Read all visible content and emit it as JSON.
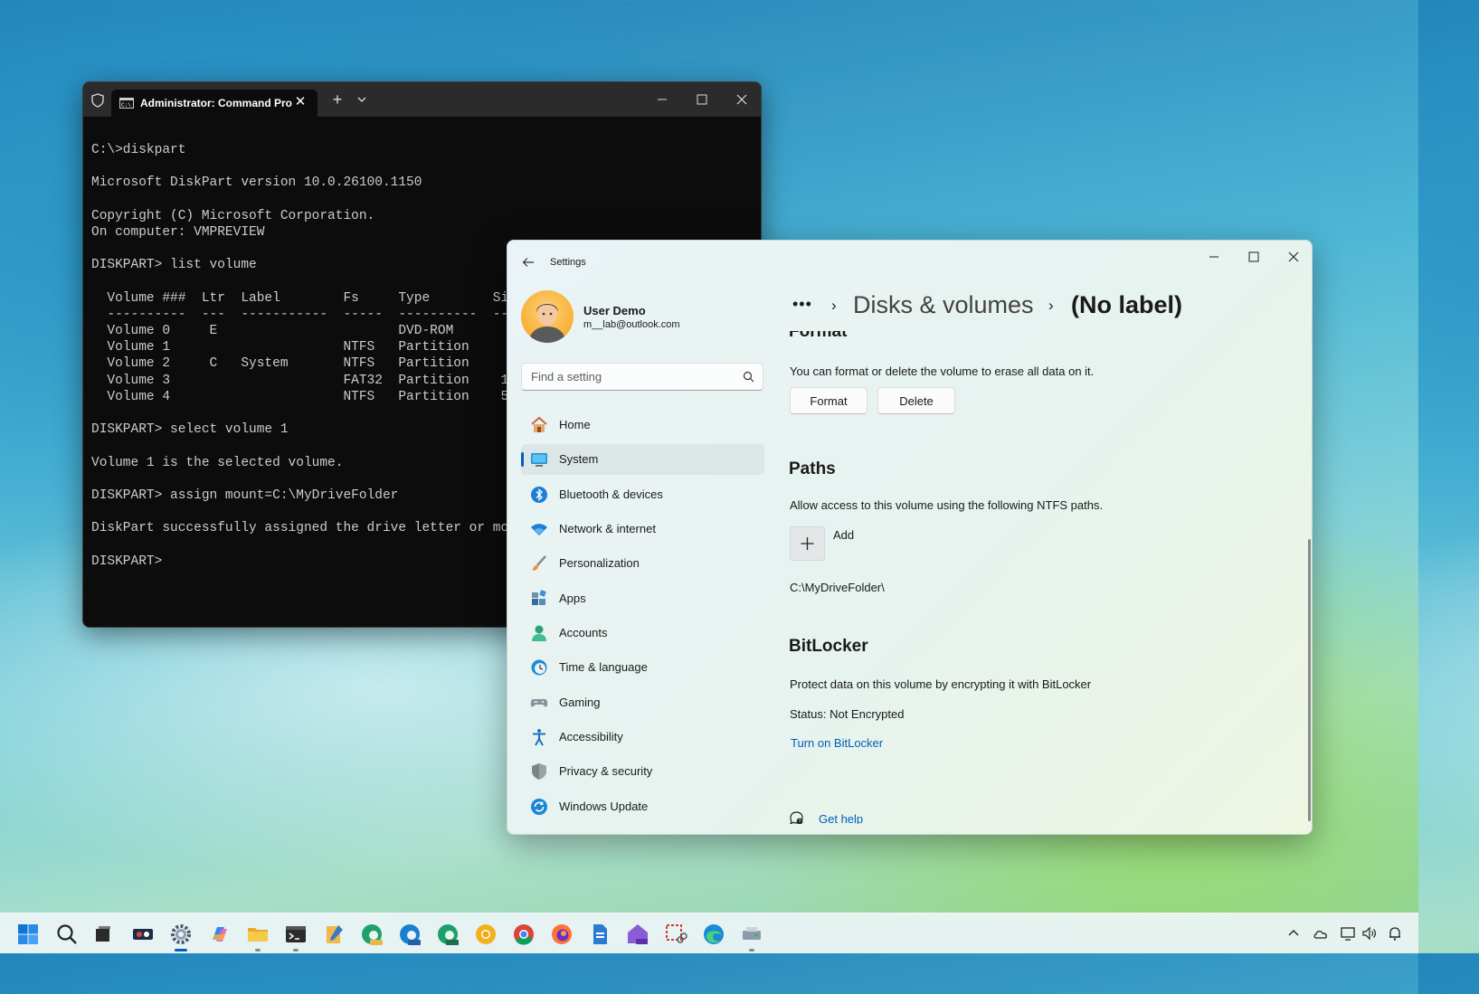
{
  "terminal": {
    "tab_title": "Administrator: Command Pro",
    "lines": [
      "C:\\>diskpart",
      "",
      "Microsoft DiskPart version 10.0.26100.1150",
      "",
      "Copyright (C) Microsoft Corporation.",
      "On computer: VMPREVIEW",
      "",
      "DISKPART> list volume",
      "",
      "  Volume ###  Ltr  Label        Fs     Type        Si",
      "  ----------  ---  -----------  -----  ----------  --",
      "  Volume 0     E                       DVD-ROM",
      "  Volume 1                      NTFS   Partition",
      "  Volume 2     C   System       NTFS   Partition",
      "  Volume 3                      FAT32  Partition    1",
      "  Volume 4                      NTFS   Partition    5",
      "",
      "DISKPART> select volume 1",
      "",
      "Volume 1 is the selected volume.",
      "",
      "DISKPART> assign mount=C:\\MyDriveFolder",
      "",
      "DiskPart successfully assigned the drive letter or mo",
      "",
      "DISKPART>"
    ]
  },
  "settings": {
    "title": "Settings",
    "user": {
      "name": "User Demo",
      "email": "m__lab@outlook.com"
    },
    "search": {
      "placeholder": "Find a setting"
    },
    "nav": [
      {
        "label": "Home",
        "icon": "home-icon"
      },
      {
        "label": "System",
        "icon": "system-icon",
        "selected": true
      },
      {
        "label": "Bluetooth & devices",
        "icon": "bluetooth-icon"
      },
      {
        "label": "Network & internet",
        "icon": "wifi-icon"
      },
      {
        "label": "Personalization",
        "icon": "brush-icon"
      },
      {
        "label": "Apps",
        "icon": "apps-icon"
      },
      {
        "label": "Accounts",
        "icon": "accounts-icon"
      },
      {
        "label": "Time & language",
        "icon": "clock-globe-icon"
      },
      {
        "label": "Gaming",
        "icon": "gamepad-icon"
      },
      {
        "label": "Accessibility",
        "icon": "accessibility-icon"
      },
      {
        "label": "Privacy & security",
        "icon": "shield-icon"
      },
      {
        "label": "Windows Update",
        "icon": "update-icon"
      }
    ],
    "breadcrumb": {
      "more": "•••",
      "parent": "Disks & volumes",
      "current": "(No label)"
    },
    "format": {
      "heading": "Format",
      "description": "You can format or delete the volume to erase all data on it.",
      "format_button": "Format",
      "delete_button": "Delete"
    },
    "paths": {
      "heading": "Paths",
      "description": "Allow access to this volume using the following NTFS paths.",
      "add_label": "Add",
      "path": "C:\\MyDriveFolder\\"
    },
    "bitlocker": {
      "heading": "BitLocker",
      "description": "Protect data on this volume by encrypting it with BitLocker",
      "status": "Status: Not Encrypted",
      "turn_on_link": "Turn on BitLocker"
    },
    "get_help": "Get help"
  },
  "colors": {
    "accent": "#005fb8",
    "terminal_bg": "#0c0c0c",
    "terminal_text": "#cccccc"
  }
}
